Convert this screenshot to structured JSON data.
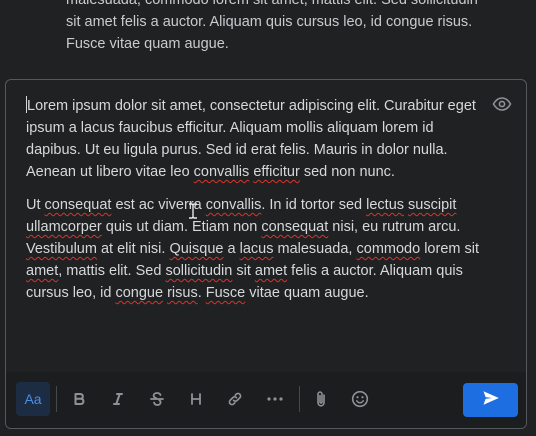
{
  "previous_message": {
    "lines": [
      "malesuada, commodo lorem sit amet, mattis elit. Sed sollicitudin",
      "sit amet felis a auctor. Aliquam quis cursus leo, id congue risus.",
      "Fusce vitae quam augue."
    ]
  },
  "editor": {
    "p1": {
      "a": "Lorem ipsum dolor sit amet, consectetur adipiscing elit. Curabitur eget ipsum a lacus faucibus efficitur. Aliquam mollis aliquam lorem id dapibus. Ut eu ligula purus. Sed id erat felis. Mauris in dolor nulla. Aenean ut libero vitae leo ",
      "s1": "convallis",
      "b": " ",
      "s2": "efficitur",
      "c": " sed non nunc."
    },
    "p2": {
      "a": "Ut ",
      "s1": "consequat",
      "b": " est ac viverra ",
      "s2": "convallis",
      "c": ". In id tortor sed ",
      "s3": "lectus",
      "d": " ",
      "s4": "suscipit",
      "e": " ",
      "s5": "ullamcorper",
      "f": " quis ut diam. Etiam non ",
      "s6": "consequat",
      "g": " nisi, eu rutrum arcu. ",
      "s7": "Vestibulum",
      "h": " at elit nisi. ",
      "s8": "Quisque",
      "i": " a ",
      "s9": "lacus",
      "j": " malesuada, ",
      "s10": "commodo",
      "k": " lorem sit ",
      "s11": "amet",
      "l": ", mattis elit. Sed ",
      "s12": "sollicitudin",
      "m": " sit ",
      "s13": "amet",
      "n": " felis a auctor. Aliquam quis cursus leo, id ",
      "s14": "congue",
      "o": " ",
      "s15": "risus",
      "p": ". ",
      "s16": "Fusce",
      "q": " vitae quam augue."
    }
  },
  "toolbar": {
    "format_label": "Aa",
    "icons": [
      "bold-icon",
      "italic-icon",
      "strikethrough-icon",
      "heading-icon",
      "link-icon",
      "more-icon",
      "paperclip-icon",
      "emoji-icon",
      "send-icon",
      "eye-icon"
    ]
  },
  "colors": {
    "background": "#1f2123",
    "toolbar": "#1b1d1f",
    "border": "#55595d",
    "text": "#d6d8da",
    "muted_icon": "#8e9296",
    "accent": "#1d6ee0",
    "format_active_bg": "#1b2c43",
    "spellcheck": "#d9342b"
  }
}
